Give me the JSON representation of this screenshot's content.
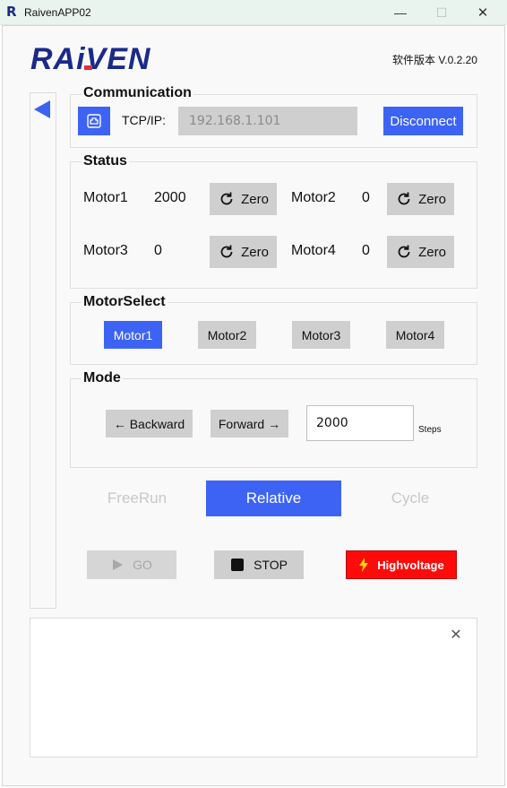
{
  "window": {
    "app_icon": "R",
    "title": "RaivenAPP02",
    "minimize_glyph": "—",
    "maximize_glyph": "☐",
    "close_glyph": "✕"
  },
  "header": {
    "logo_text": "RAiVEN",
    "version": "软件版本 V.0.2.20"
  },
  "communication": {
    "title": "Communication",
    "network_icon": "network-icon",
    "tcp_label": "TCP/IP:",
    "ip_placeholder": "192.168.1.101",
    "disconnect_label": "Disconnect"
  },
  "status": {
    "title": "Status",
    "motors": [
      {
        "label": "Motor1",
        "value": "2000",
        "zero_label": "Zero"
      },
      {
        "label": "Motor2",
        "value": "0",
        "zero_label": "Zero"
      },
      {
        "label": "Motor3",
        "value": "0",
        "zero_label": "Zero"
      },
      {
        "label": "Motor4",
        "value": "0",
        "zero_label": "Zero"
      }
    ]
  },
  "motor_select": {
    "title": "MotorSelect",
    "options": [
      "Motor1",
      "Motor2",
      "Motor3",
      "Motor4"
    ],
    "selected": "Motor1"
  },
  "mode": {
    "title": "Mode",
    "backward_label": "← Backward",
    "forward_label": "Forward →",
    "steps_value": "2000",
    "steps_unit": "Steps"
  },
  "run_modes": {
    "tabs": [
      "FreeRun",
      "Relative",
      "Cycle"
    ],
    "active": "Relative"
  },
  "actions": {
    "go_label": "GO",
    "stop_label": "STOP",
    "highvoltage_label": "Highvoltage"
  },
  "log": {
    "close_glyph": "✕"
  },
  "colors": {
    "accent_blue": "#3d63f5",
    "button_gray": "#cfcfcf",
    "danger_red": "#ff0a0a",
    "logo_navy": "#1b2a8a",
    "logo_red": "#e0303a"
  }
}
